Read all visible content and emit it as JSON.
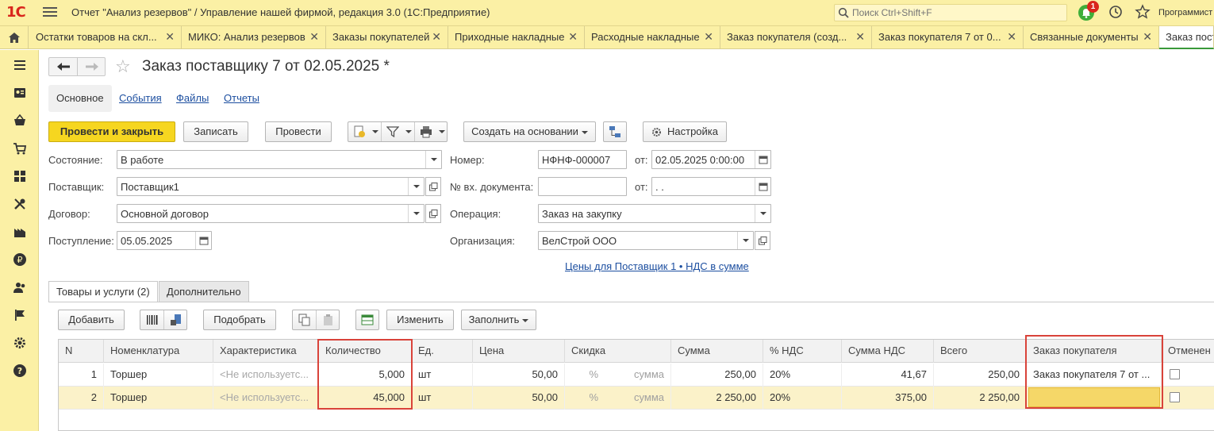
{
  "app": {
    "logo": "1С",
    "title": "Отчет \"Анализ резервов\" / Управление нашей фирмой, редакция 3.0  (1С:Предприятие)",
    "search_placeholder": "Поиск Ctrl+Shift+F",
    "notifications_count": "1",
    "username": "Программист"
  },
  "tabs": [
    {
      "label": "Остатки товаров на скл..."
    },
    {
      "label": "МИКО: Анализ резервов"
    },
    {
      "label": "Заказы покупателей"
    },
    {
      "label": "Приходные накладные"
    },
    {
      "label": "Расходные накладные"
    },
    {
      "label": "Заказ покупателя (созд..."
    },
    {
      "label": "Заказ покупателя 7 от 0..."
    },
    {
      "label": "Связанные документы"
    },
    {
      "label": "Заказ поставщ"
    }
  ],
  "sidebar_icons": [
    "menu-icon",
    "contacts-icon",
    "basket-icon",
    "cart-icon",
    "grid-icon",
    "tools-icon",
    "factory-icon",
    "ruble-icon",
    "people-icon",
    "flag-icon",
    "gear-icon",
    "help-icon"
  ],
  "document": {
    "title": "Заказ поставщику 7 от 02.05.2025 *",
    "sections": {
      "main": "Основное",
      "events": "События",
      "files": "Файлы",
      "reports": "Отчеты"
    }
  },
  "toolbar": {
    "post_close": "Провести и закрыть",
    "save": "Записать",
    "post": "Провести",
    "create_based": "Создать на основании",
    "settings": "Настройка"
  },
  "form": {
    "state_label": "Состояние:",
    "state_value": "В работе",
    "supplier_label": "Поставщик:",
    "supplier_value": "Поставщик1",
    "contract_label": "Договор:",
    "contract_value": "Основной договор",
    "arrival_label": "Поступление:",
    "arrival_value": "05.05.2025",
    "number_label": "Номер:",
    "number_value": "НФНФ-000007",
    "from_label": "от:",
    "date_value": "02.05.2025  0:00:00",
    "incoming_label": "№ вх. документа:",
    "incoming_value": "",
    "incoming_from_label": "от:",
    "incoming_date_value": " .  .",
    "operation_label": "Операция:",
    "operation_value": "Заказ на закупку",
    "org_label": "Организация:",
    "org_value": "ВелСтрой ООО",
    "prices_link": "Цены для Поставщик 1 • НДС в сумме"
  },
  "tabpages": {
    "goods": "Товары и услуги (2)",
    "extra": "Дополнительно"
  },
  "table_toolbar": {
    "add": "Добавить",
    "pick": "Подобрать",
    "change": "Изменить",
    "fill": "Заполнить"
  },
  "table": {
    "headers": {
      "n": "N",
      "item": "Номенклатура",
      "char": "Характеристика",
      "qty": "Количество",
      "unit": "Ед.",
      "price": "Цена",
      "discount": "Скидка",
      "sum": "Сумма",
      "vat_rate": "% НДС",
      "vat_sum": "Сумма НДС",
      "total": "Всего",
      "customer_order": "Заказ покупателя",
      "cancelled": "Отменен"
    },
    "rows": [
      {
        "n": "1",
        "item": "Торшер",
        "char": "<Не используетс...",
        "qty": "5,000",
        "unit": "шт",
        "price": "50,00",
        "disc_pct": "%",
        "disc_sum": "сумма",
        "sum": "250,00",
        "vat_rate": "20%",
        "vat_sum": "41,67",
        "total": "250,00",
        "customer_order": "Заказ покупателя 7 от ..."
      },
      {
        "n": "2",
        "item": "Торшер",
        "char": "<Не используетс...",
        "qty": "45,000",
        "unit": "шт",
        "price": "50,00",
        "disc_pct": "%",
        "disc_sum": "сумма",
        "sum": "2 250,00",
        "vat_rate": "20%",
        "vat_sum": "375,00",
        "total": "2 250,00",
        "customer_order": ""
      }
    ]
  }
}
